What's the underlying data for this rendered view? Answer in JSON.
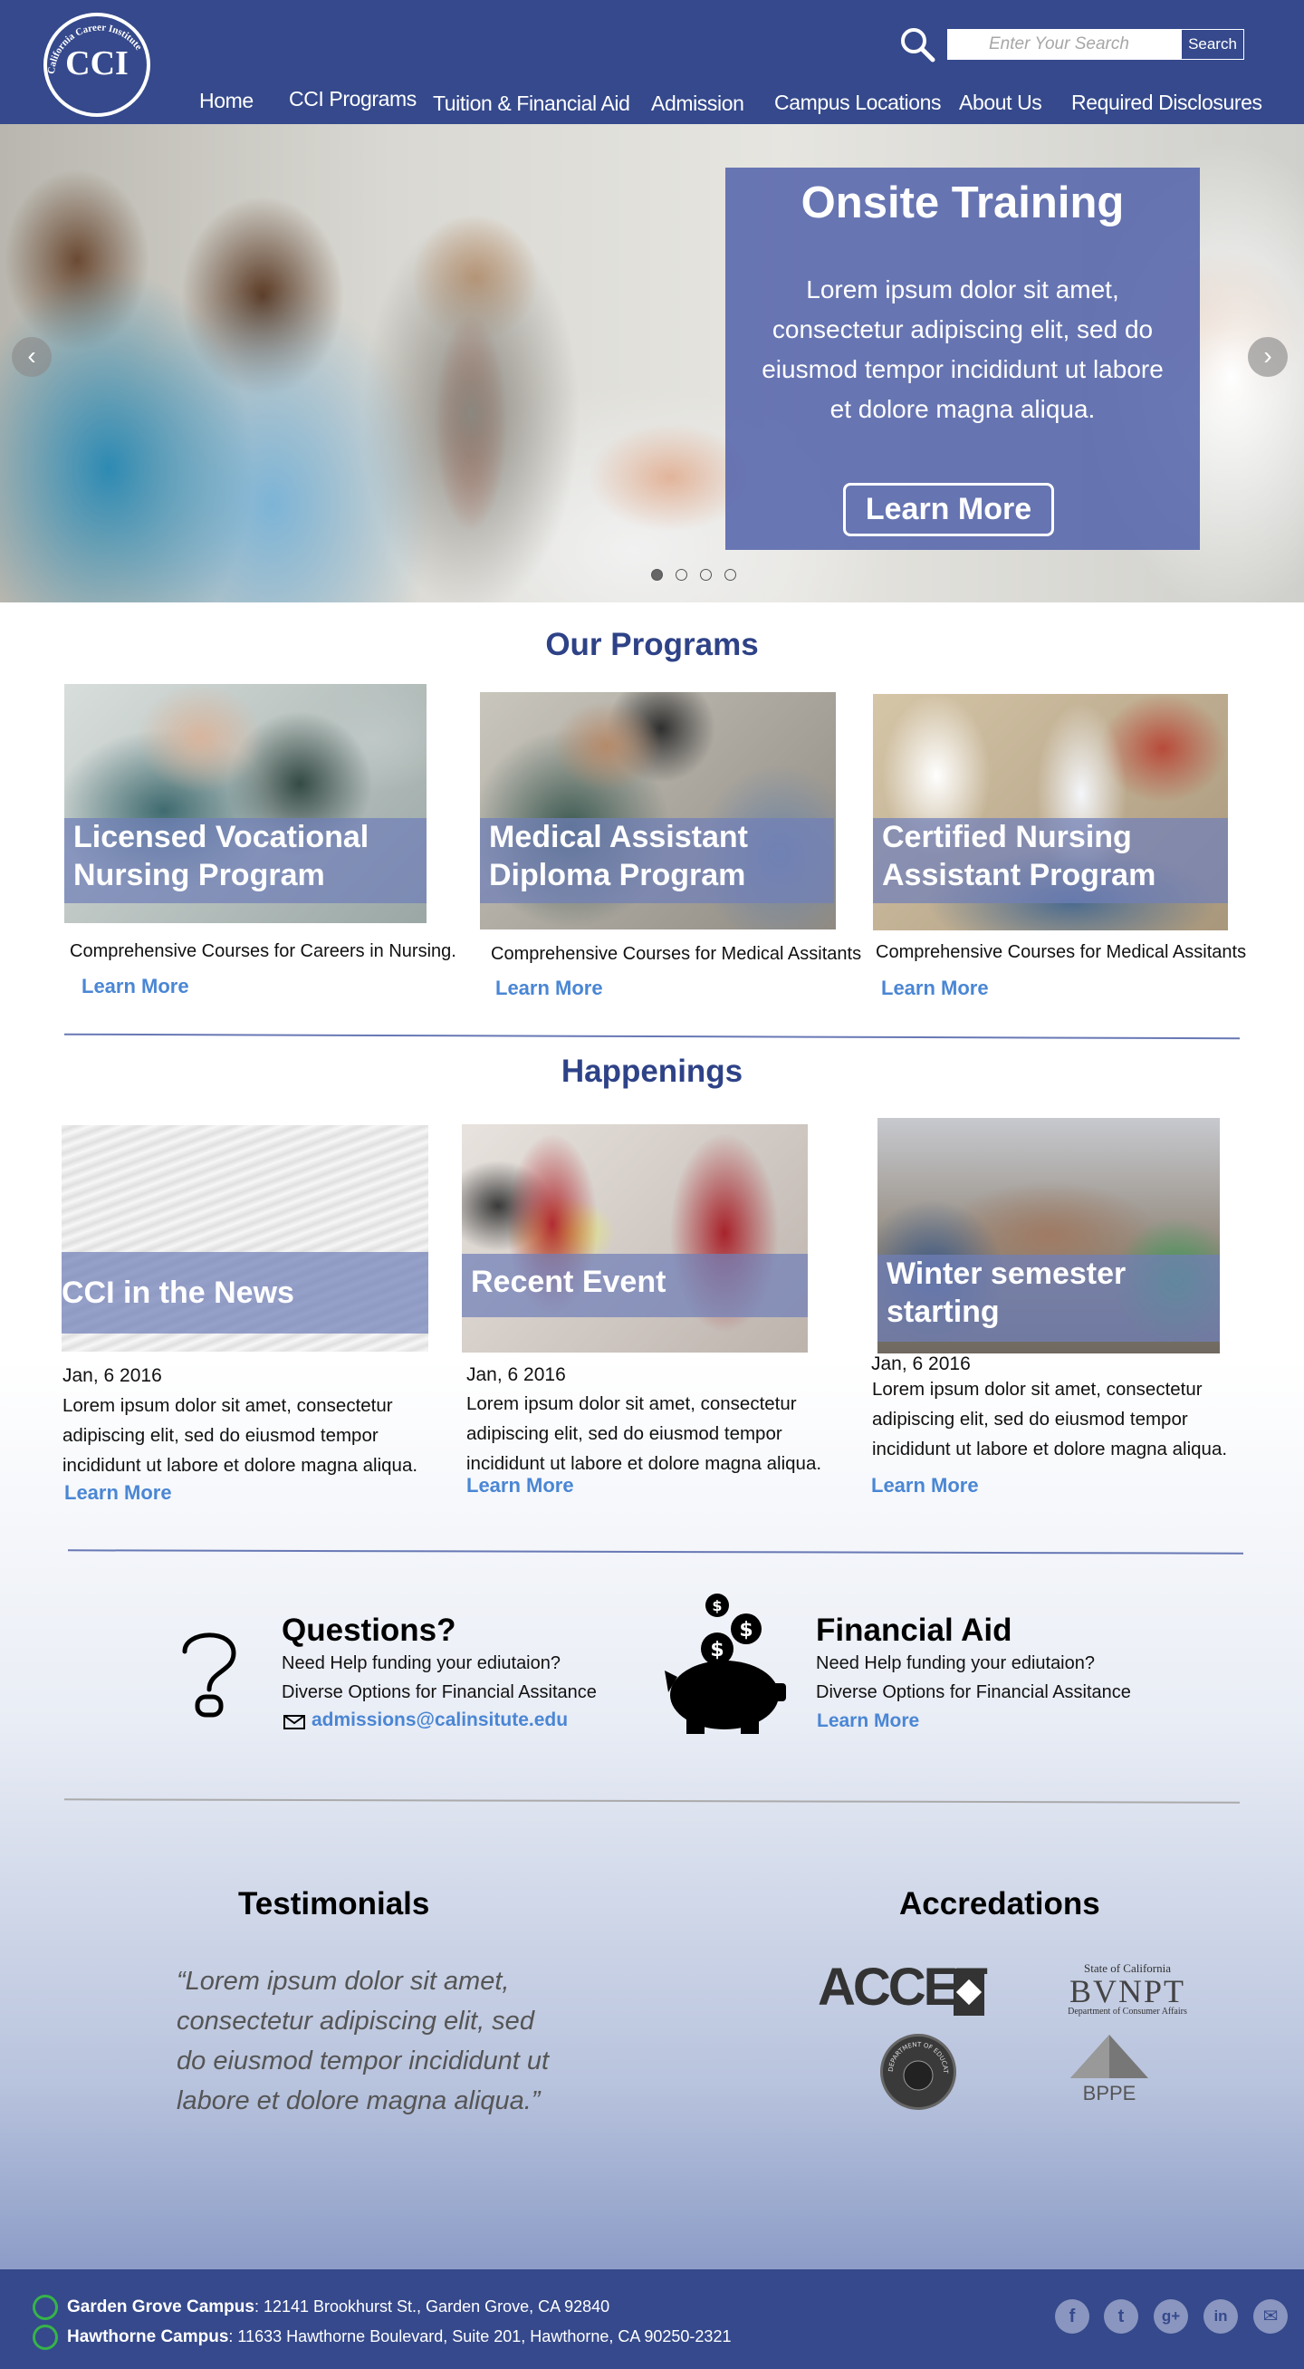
{
  "header": {
    "logo_text": "CCI",
    "logo_arc_text": "California Career Institute",
    "search_placeholder": "Enter Your Search",
    "search_button": "Search",
    "nav": [
      "Home",
      "CCI Programs",
      "Tuition & Financial Aid",
      "Admission",
      "Campus Locations",
      "About Us",
      "Required Disclosures"
    ]
  },
  "hero": {
    "title": "Onsite Training",
    "text": "Lorem ipsum dolor sit amet, consectetur adipiscing elit, sed do eiusmod tempor incididunt ut labore et dolore magna aliqua.",
    "button": "Learn More",
    "prev_icon": "chevron-left-icon",
    "next_icon": "chevron-right-icon",
    "slides": 4,
    "active_slide": 1
  },
  "programs": {
    "title": "Our Programs",
    "items": [
      {
        "title_line1": "Licensed Vocational",
        "title_line2": "Nursing Program",
        "desc": "Comprehensive Courses for Careers in Nursing.",
        "link": "Learn More"
      },
      {
        "title_line1": "Medical Assistant",
        "title_line2": "Diploma Program",
        "desc": "Comprehensive Courses for Medical Assitants",
        "link": "Learn More"
      },
      {
        "title_line1": "Certified Nursing",
        "title_line2": "Assistant Program",
        "desc": "Comprehensive Courses for Medical Assitants",
        "link": "Learn More"
      }
    ]
  },
  "happenings": {
    "title": "Happenings",
    "items": [
      {
        "title_line1": "CCI in the News",
        "title_line2": "",
        "date": "Jan, 6 2016",
        "text": "Lorem ipsum dolor sit amet, consectetur adipiscing elit, sed do eiusmod tempor incididunt ut labore et dolore magna aliqua.",
        "link": "Learn More"
      },
      {
        "title_line1": "Recent Event",
        "title_line2": "",
        "date": "Jan, 6 2016",
        "text": "Lorem ipsum dolor sit amet, consectetur adipiscing elit, sed do eiusmod tempor incididunt ut labore et dolore magna aliqua.",
        "link": "Learn More"
      },
      {
        "title_line1": "Winter semester",
        "title_line2": "starting",
        "date": "Jan, 6 2016",
        "text": "Lorem ipsum dolor sit amet, consectetur adipiscing elit, sed do eiusmod tempor incididunt ut labore et dolore magna aliqua.",
        "link": "Learn More"
      }
    ]
  },
  "questions": {
    "title": "Questions?",
    "line1": "Need Help funding your ediutaion?",
    "line2": "Diverse Options for Financial Assitance",
    "email": "admissions@calinsitute.edu",
    "icon": "question-mark-icon"
  },
  "financial_aid": {
    "title": "Financial Aid",
    "line1": "Need Help funding your ediutaion?",
    "line2": "Diverse Options for Financial Assitance",
    "link": "Learn More",
    "icon": "piggy-bank-icon"
  },
  "testimonials": {
    "title": "Testimonials",
    "quote": "“Lorem ipsum dolor sit amet, consectetur adipiscing elit, sed do eiusmod tempor incididunt ut labore et dolore magna aliqua.”"
  },
  "accreditations": {
    "title": "Accredations",
    "accet": "ACCET",
    "bvnpt_top": "State of California",
    "bvnpt": "BVNPT",
    "bvnpt_sub": "Department of Consumer Affairs",
    "doe": "DEPARTMENT OF EDUCATION",
    "bppe": "BPPE"
  },
  "footer": {
    "campus1_name": "Garden Grove Campus",
    "campus1_addr": ": 12141 Brookhurst St., Garden Grove, CA 92840",
    "campus2_name": "Hawthorne Campus",
    "campus2_addr": ": 11633 Hawthorne Boulevard, Suite 201, Hawthorne, CA 90250-2321",
    "social": [
      "facebook-icon",
      "twitter-icon",
      "google-plus-icon",
      "linkedin-icon",
      "email-icon"
    ]
  },
  "colors": {
    "brand": "#35498c",
    "heading": "#2e4287",
    "link": "#4a86d4",
    "overlay": "#5161aa"
  }
}
